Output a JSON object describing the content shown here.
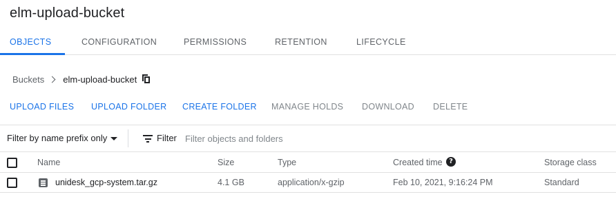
{
  "page": {
    "title": "elm-upload-bucket"
  },
  "tabs": [
    {
      "label": "OBJECTS",
      "active": true
    },
    {
      "label": "CONFIGURATION"
    },
    {
      "label": "PERMISSIONS"
    },
    {
      "label": "RETENTION"
    },
    {
      "label": "LIFECYCLE"
    }
  ],
  "breadcrumb": {
    "root": "Buckets",
    "current": "elm-upload-bucket",
    "copy_icon": "copy-icon"
  },
  "actions": {
    "upload_files": "UPLOAD FILES",
    "upload_folder": "UPLOAD FOLDER",
    "create_folder": "CREATE FOLDER",
    "manage_holds": "MANAGE HOLDS",
    "download": "DOWNLOAD",
    "delete": "DELETE"
  },
  "filter": {
    "select_value": "Filter by name prefix only",
    "filter_label": "Filter",
    "placeholder": "Filter objects and folders"
  },
  "table": {
    "headers": {
      "name": "Name",
      "size": "Size",
      "type": "Type",
      "created": "Created time",
      "storage": "Storage class"
    },
    "rows": [
      {
        "name": "unidesk_gcp-system.tar.gz",
        "size": "4.1 GB",
        "type": "application/x-gzip",
        "created": "Feb 10, 2021, 9:16:24 PM",
        "storage": "Standard"
      }
    ]
  },
  "colors": {
    "accent": "#1a73e8",
    "text": "#202124",
    "muted": "#5f6368",
    "disabled": "#80868b",
    "border": "#e0e0e0"
  }
}
